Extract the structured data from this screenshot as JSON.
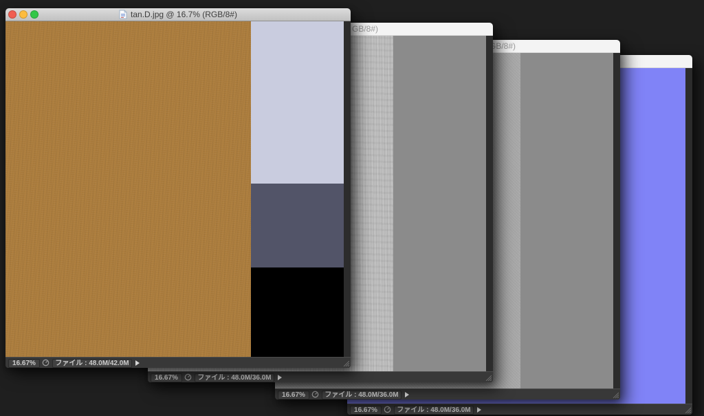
{
  "desktop": {
    "background_color": "#1f1f1f"
  },
  "icons": {
    "traffic_lights": [
      "close-button",
      "minimize-button",
      "zoom-button"
    ],
    "title_doc_icon": "jpeg-document-icon",
    "status_clock_icon": "timer-clock-icon",
    "status_arrow_icon": "popup-arrow-icon",
    "resize_grip_icon": "resize-grip-icon"
  },
  "windows": [
    {
      "name": "tan-document",
      "active": true,
      "title": "tan.D.jpg @ 16.7% (RGB/8#)",
      "statusbar": {
        "zoom_level": "16.67%",
        "file_info": "ファイル : 48.0M/42.0M"
      },
      "swatches": {
        "main": "#ac7d3d",
        "top": "#c9ccdf",
        "middle": "#525468",
        "bottom": "#000000"
      }
    },
    {
      "name": "paper-document-1",
      "active": false,
      "title_fragment": "GB/8#)",
      "statusbar": {
        "zoom_level": "16.67%",
        "file_info": "ファイル : 48.0M/36.0M"
      },
      "swatches": {
        "main": "#c6c6c6",
        "right": "#8b8b8b"
      }
    },
    {
      "name": "paper-document-2",
      "active": false,
      "title_fragment": "GB/8#)",
      "statusbar": {
        "zoom_level": "16.67%",
        "file_info": "ファイル : 48.0M/36.0M"
      },
      "swatches": {
        "main": "#a9a9a9",
        "right": "#8b8b8b"
      }
    },
    {
      "name": "purple-document",
      "active": false,
      "title_fragment": "",
      "statusbar": {
        "zoom_level": "16.67%",
        "file_info": "ファイル : 48.0M/36.0M"
      },
      "swatches": {
        "main": "#8083f7"
      }
    }
  ]
}
